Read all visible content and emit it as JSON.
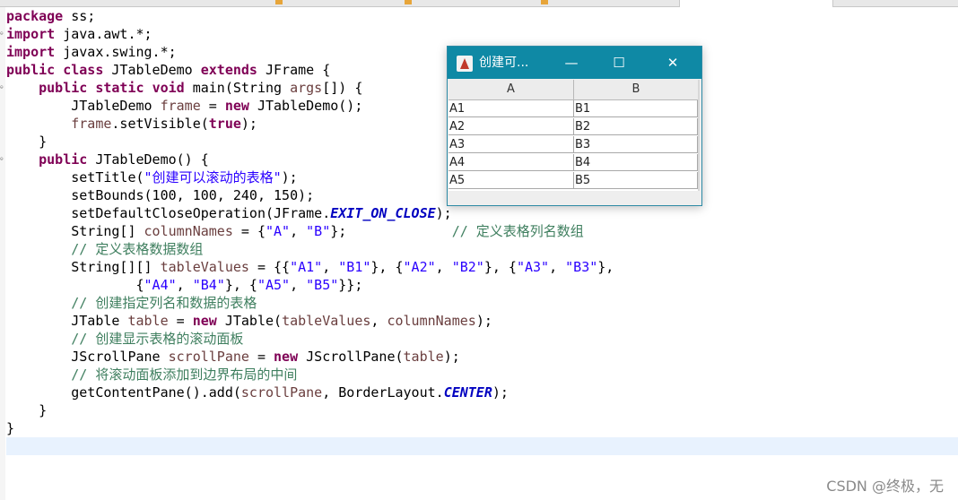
{
  "code_lines": [
    "package ss;",
    "import java.awt.*;",
    "import javax.swing.*;",
    "public class JTableDemo extends JFrame {",
    "    public static void main(String args[]) {",
    "        JTableDemo frame = new JTableDemo();",
    "        frame.setVisible(true);",
    "    }",
    "    public JTableDemo() {",
    "        setTitle(\"创建可以滚动的表格\");",
    "        setBounds(100, 100, 240, 150);",
    "        setDefaultCloseOperation(JFrame.EXIT_ON_CLOSE);",
    "        String[] columnNames = {\"A\", \"B\"};             // 定义表格列名数组",
    "        // 定义表格数据数组",
    "        String[][] tableValues = {{\"A1\", \"B1\"}, {\"A2\", \"B2\"}, {\"A3\", \"B3\"},",
    "                {\"A4\", \"B4\"}, {\"A5\", \"B5\"}};",
    "        // 创建指定列名和数据的表格",
    "        JTable table = new JTable(tableValues, columnNames);",
    "        // 创建显示表格的滚动面板",
    "        JScrollPane scrollPane = new JScrollPane(table);",
    "        // 将滚动面板添加到边界布局的中间",
    "        getContentPane().add(scrollPane, BorderLayout.CENTER);",
    "    }",
    "}"
  ],
  "window": {
    "title": "创建可...",
    "minimize": "—",
    "maximize": "☐",
    "close": "✕",
    "columns": [
      "A",
      "B"
    ],
    "rows": [
      [
        "A1",
        "B1"
      ],
      [
        "A2",
        "B2"
      ],
      [
        "A3",
        "B3"
      ],
      [
        "A4",
        "B4"
      ],
      [
        "A5",
        "B5"
      ]
    ]
  },
  "watermark": "CSDN @终极，无",
  "colors": {
    "keyword": "#7f0055",
    "string": "#2a00ff",
    "comment": "#3f7f5f",
    "field": "#0000c0",
    "window_titlebar": "#0f89a5",
    "current_line": "#e8f2fe"
  }
}
